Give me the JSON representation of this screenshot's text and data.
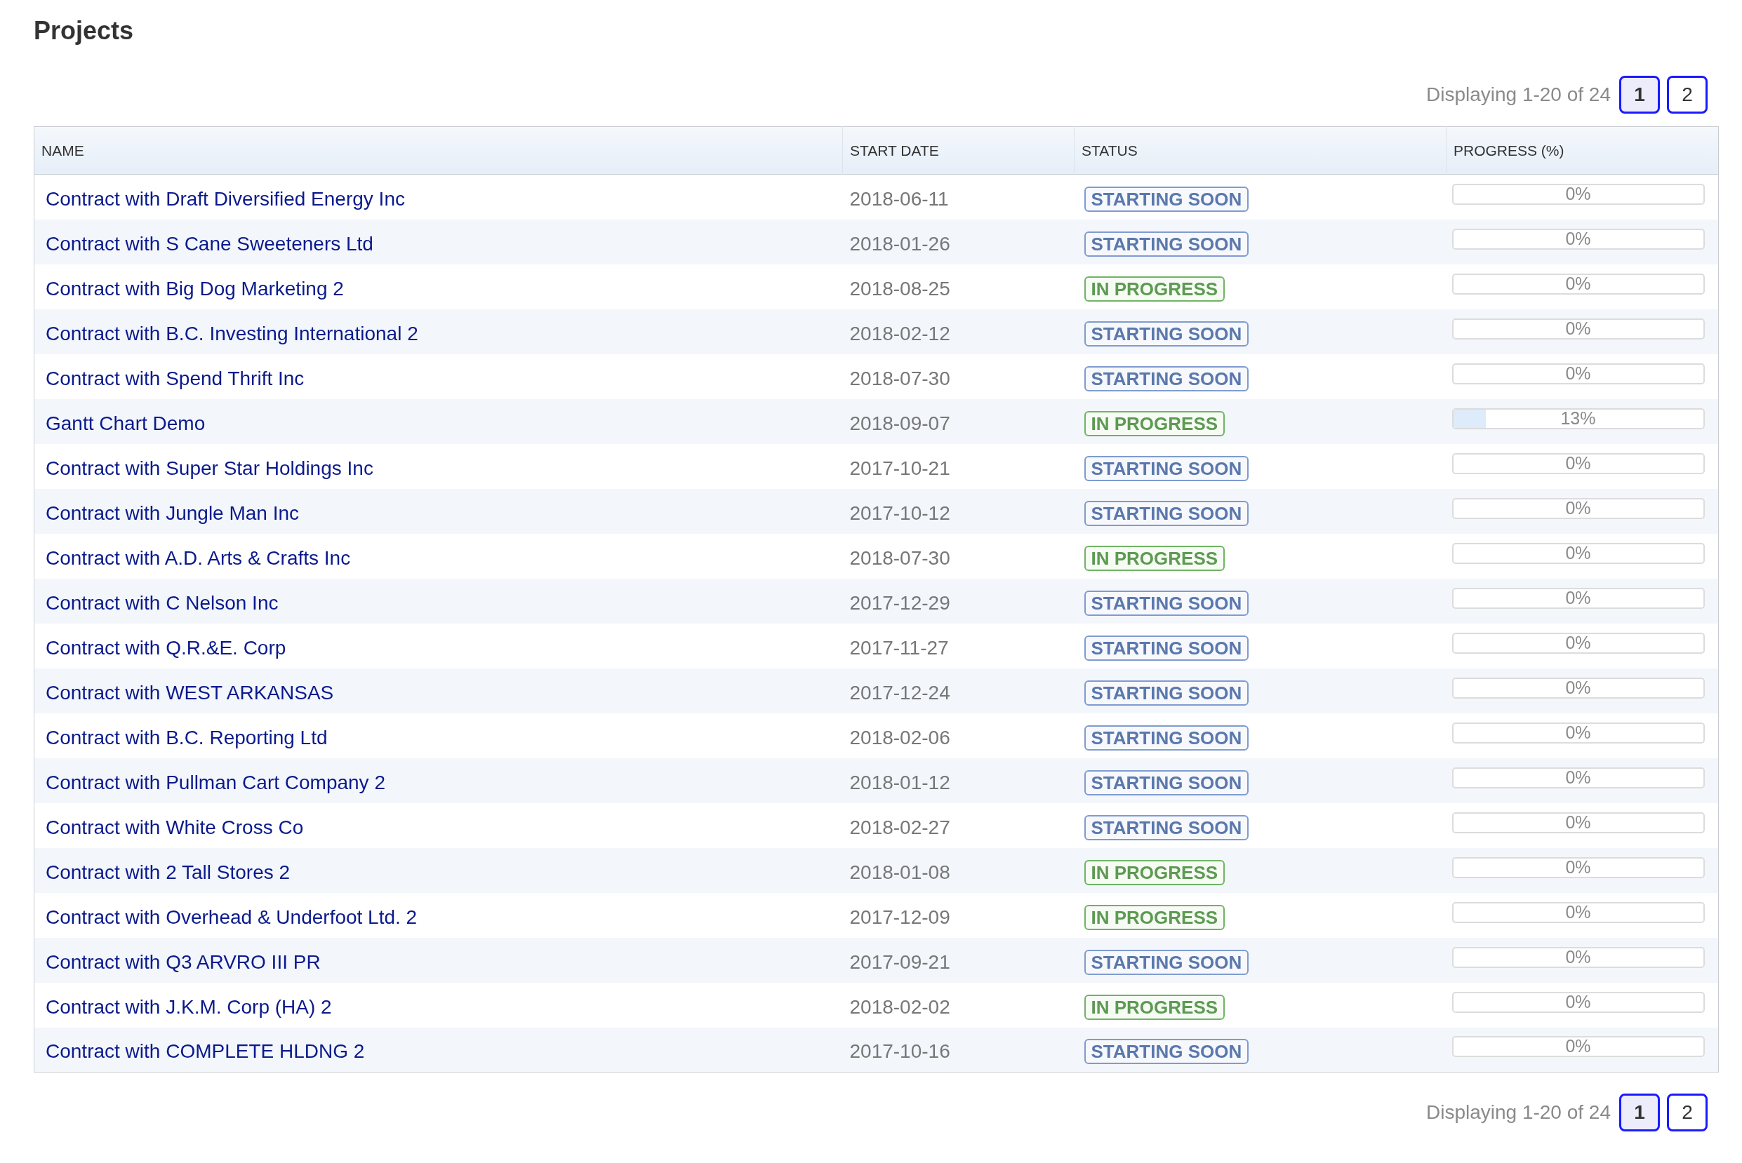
{
  "title": "Projects",
  "pagination_top": {
    "summary": "Displaying 1-20 of 24",
    "pages": [
      {
        "label": "1",
        "selected": true
      },
      {
        "label": "2",
        "selected": false
      }
    ]
  },
  "table": {
    "columns": [
      "NAME",
      "START DATE",
      "STATUS",
      "PROGRESS (%)"
    ],
    "rows": [
      {
        "name": "Contract with Draft Diversified Energy Inc",
        "start_date": "2018-06-11",
        "status": {
          "kind": "starting_soon",
          "label": "STARTING SOON"
        },
        "progress": {
          "level": 0,
          "reading": "0%"
        }
      },
      {
        "name": "Contract with S Cane Sweeteners Ltd",
        "start_date": "2018-01-26",
        "status": {
          "kind": "starting_soon",
          "label": "STARTING SOON"
        },
        "progress": {
          "level": 0,
          "reading": "0%"
        }
      },
      {
        "name": "Contract with Big Dog Marketing 2",
        "start_date": "2018-08-25",
        "status": {
          "kind": "in_progress",
          "label": "IN PROGRESS"
        },
        "progress": {
          "level": 0,
          "reading": "0%"
        }
      },
      {
        "name": "Contract with B.C. Investing International 2",
        "start_date": "2018-02-12",
        "status": {
          "kind": "starting_soon",
          "label": "STARTING SOON"
        },
        "progress": {
          "level": 0,
          "reading": "0%"
        }
      },
      {
        "name": "Contract with Spend Thrift Inc",
        "start_date": "2018-07-30",
        "status": {
          "kind": "starting_soon",
          "label": "STARTING SOON"
        },
        "progress": {
          "level": 0,
          "reading": "0%"
        }
      },
      {
        "name": "Gantt Chart Demo",
        "start_date": "2018-09-07",
        "status": {
          "kind": "in_progress",
          "label": "IN PROGRESS"
        },
        "progress": {
          "level": 0.13,
          "reading": "13%"
        }
      },
      {
        "name": "Contract with Super Star Holdings Inc",
        "start_date": "2017-10-21",
        "status": {
          "kind": "starting_soon",
          "label": "STARTING SOON"
        },
        "progress": {
          "level": 0,
          "reading": "0%"
        }
      },
      {
        "name": "Contract with Jungle Man Inc",
        "start_date": "2017-10-12",
        "status": {
          "kind": "starting_soon",
          "label": "STARTING SOON"
        },
        "progress": {
          "level": 0,
          "reading": "0%"
        }
      },
      {
        "name": "Contract with A.D. Arts & Crafts Inc",
        "start_date": "2018-07-30",
        "status": {
          "kind": "in_progress",
          "label": "IN PROGRESS"
        },
        "progress": {
          "level": 0,
          "reading": "0%"
        }
      },
      {
        "name": "Contract with C Nelson Inc",
        "start_date": "2017-12-29",
        "status": {
          "kind": "starting_soon",
          "label": "STARTING SOON"
        },
        "progress": {
          "level": 0,
          "reading": "0%"
        }
      },
      {
        "name": "Contract with Q.R.&E. Corp",
        "start_date": "2017-11-27",
        "status": {
          "kind": "starting_soon",
          "label": "STARTING SOON"
        },
        "progress": {
          "level": 0,
          "reading": "0%"
        }
      },
      {
        "name": "Contract with WEST ARKANSAS",
        "start_date": "2017-12-24",
        "status": {
          "kind": "starting_soon",
          "label": "STARTING SOON"
        },
        "progress": {
          "level": 0,
          "reading": "0%"
        }
      },
      {
        "name": "Contract with B.C. Reporting Ltd",
        "start_date": "2018-02-06",
        "status": {
          "kind": "starting_soon",
          "label": "STARTING SOON"
        },
        "progress": {
          "level": 0,
          "reading": "0%"
        }
      },
      {
        "name": "Contract with Pullman Cart Company 2",
        "start_date": "2018-01-12",
        "status": {
          "kind": "starting_soon",
          "label": "STARTING SOON"
        },
        "progress": {
          "level": 0,
          "reading": "0%"
        }
      },
      {
        "name": "Contract with White Cross Co",
        "start_date": "2018-02-27",
        "status": {
          "kind": "starting_soon",
          "label": "STARTING SOON"
        },
        "progress": {
          "level": 0,
          "reading": "0%"
        }
      },
      {
        "name": "Contract with 2 Tall Stores 2",
        "start_date": "2018-01-08",
        "status": {
          "kind": "in_progress",
          "label": "IN PROGRESS"
        },
        "progress": {
          "level": 0,
          "reading": "0%"
        }
      },
      {
        "name": "Contract with Overhead & Underfoot Ltd. 2",
        "start_date": "2017-12-09",
        "status": {
          "kind": "in_progress",
          "label": "IN PROGRESS"
        },
        "progress": {
          "level": 0,
          "reading": "0%"
        }
      },
      {
        "name": "Contract with Q3 ARVRO III PR",
        "start_date": "2017-09-21",
        "status": {
          "kind": "starting_soon",
          "label": "STARTING SOON"
        },
        "progress": {
          "level": 0,
          "reading": "0%"
        }
      },
      {
        "name": "Contract with J.K.M. Corp (HA) 2",
        "start_date": "2018-02-02",
        "status": {
          "kind": "in_progress",
          "label": "IN PROGRESS"
        },
        "progress": {
          "level": 0,
          "reading": "0%"
        }
      },
      {
        "name": "Contract with COMPLETE HLDNG 2",
        "start_date": "2017-10-16",
        "status": {
          "kind": "starting_soon",
          "label": "STARTING SOON"
        },
        "progress": {
          "level": 0,
          "reading": "0%"
        }
      }
    ]
  },
  "pagination_bottom": {
    "summary": "Displaying 1-20 of 24",
    "pages": [
      {
        "label": "1",
        "selected": true
      },
      {
        "label": "2",
        "selected": false
      }
    ]
  }
}
